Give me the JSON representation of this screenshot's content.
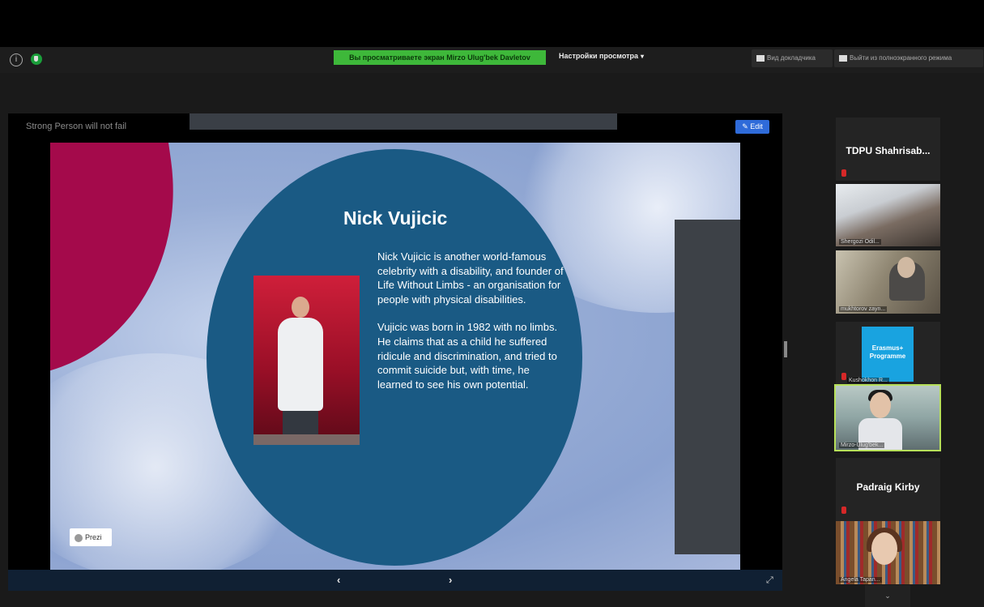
{
  "banner": {
    "text": "Вы просматриваете экран Mirzo Ulug'bek Davletov"
  },
  "top_bar": {
    "view_options": "Настройки просмотра",
    "view_options_chevron": "▾",
    "view_mode": "Вид докладчика",
    "exit_fullscreen": "Выйти из полноэкранного режима"
  },
  "presentation": {
    "stage_title": "Strong Person will not fail",
    "edit_label": "Edit",
    "slide_title": "Nick Vujicic",
    "paragraph1": "Nick Vujicic is another world-famous celebrity with a disability, and founder of Life Without Limbs - an organisation for people with physical disabilities.",
    "paragraph2": "Vujicic was born in 1982 with no limbs. He claims that as a child he suffered ridicule and discrimination, and tried to commit suicide but, with time, he learned to see his own potential.",
    "prezi_label": "Prezi",
    "prev_arrow": "‹",
    "next_arrow": "›",
    "expand_glyph": "⤢"
  },
  "participants": [
    {
      "name": "TDPU  Shahrisab...",
      "type": "name-only"
    },
    {
      "name": "Shergozi Odil...",
      "type": "video"
    },
    {
      "name": "mukhtorov zayn...",
      "type": "video"
    },
    {
      "name": "Kushokhon R...",
      "type": "logo",
      "logo_text": "Erasmus+ Programme"
    },
    {
      "name": "Mirzo-Ulug'bek...",
      "type": "video",
      "active_speaker": true
    },
    {
      "name": "Padraig Kirby",
      "type": "name-only"
    },
    {
      "name": "Angela Tapan...",
      "type": "video"
    }
  ],
  "gallery_down": "⌄",
  "colors": {
    "banner_green": "#3eb83a",
    "slide_circle": "#1a5a84",
    "slide_accent": "#a40a4b",
    "edit_blue": "#2f6bd9",
    "active_speaker": "#b7e05a",
    "mic_muted": "#d62828"
  }
}
